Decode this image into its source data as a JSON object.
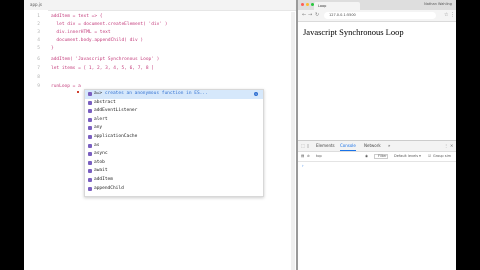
{
  "editor": {
    "tab_label": "app.js",
    "lines": [
      {
        "num": "1",
        "text": "addItem = text => {"
      },
      {
        "num": "2",
        "text": "  let div = document.createElement( 'div' )"
      },
      {
        "num": "3",
        "text": "  div.innerHTML = text"
      },
      {
        "num": "4",
        "text": "  document.body.appendChild( div )"
      },
      {
        "num": "5",
        "text": "}"
      },
      {
        "num": "6",
        "text": "addItem( 'Javascript Synchronous Loop' )"
      },
      {
        "num": "7",
        "text": "let items = [ 1, 2, 3, 4, 5, 6, 7, 8 ]"
      },
      {
        "num": "8",
        "text": ""
      },
      {
        "num": "9",
        "text": "runLoop = a"
      }
    ]
  },
  "autocomplete": {
    "items": [
      {
        "label": "a=>",
        "detail": "  creates an anonymous function in ES...",
        "selected": true
      },
      {
        "label": "abstract",
        "detail": "",
        "selected": false
      },
      {
        "label": "addEventListener",
        "detail": "",
        "selected": false
      },
      {
        "label": "alert",
        "detail": "",
        "selected": false
      },
      {
        "label": "any",
        "detail": "",
        "selected": false
      },
      {
        "label": "applicationCache",
        "detail": "",
        "selected": false
      },
      {
        "label": "as",
        "detail": "",
        "selected": false
      },
      {
        "label": "async",
        "detail": "",
        "selected": false
      },
      {
        "label": "atob",
        "detail": "",
        "selected": false
      },
      {
        "label": "await",
        "detail": "",
        "selected": false
      },
      {
        "label": "addItem",
        "detail": "",
        "selected": false
      },
      {
        "label": "appendChild",
        "detail": "",
        "selected": false
      }
    ]
  },
  "browser": {
    "tab_title": "Loop",
    "profile": "Nathan Wahling",
    "url": "127.0.0.1:5500",
    "page_heading": "Javascript Synchronous Loop",
    "traffic_colors": [
      "#ff5f57",
      "#febc2e",
      "#28c840"
    ]
  },
  "devtools": {
    "tabs": [
      "Elements",
      "Console",
      "Network",
      "»"
    ],
    "active_tab": "Console",
    "context": "top",
    "filter_placeholder": "Filter",
    "levels": "Default levels ▾",
    "group_similar": "Group sim",
    "prompt": "›"
  }
}
